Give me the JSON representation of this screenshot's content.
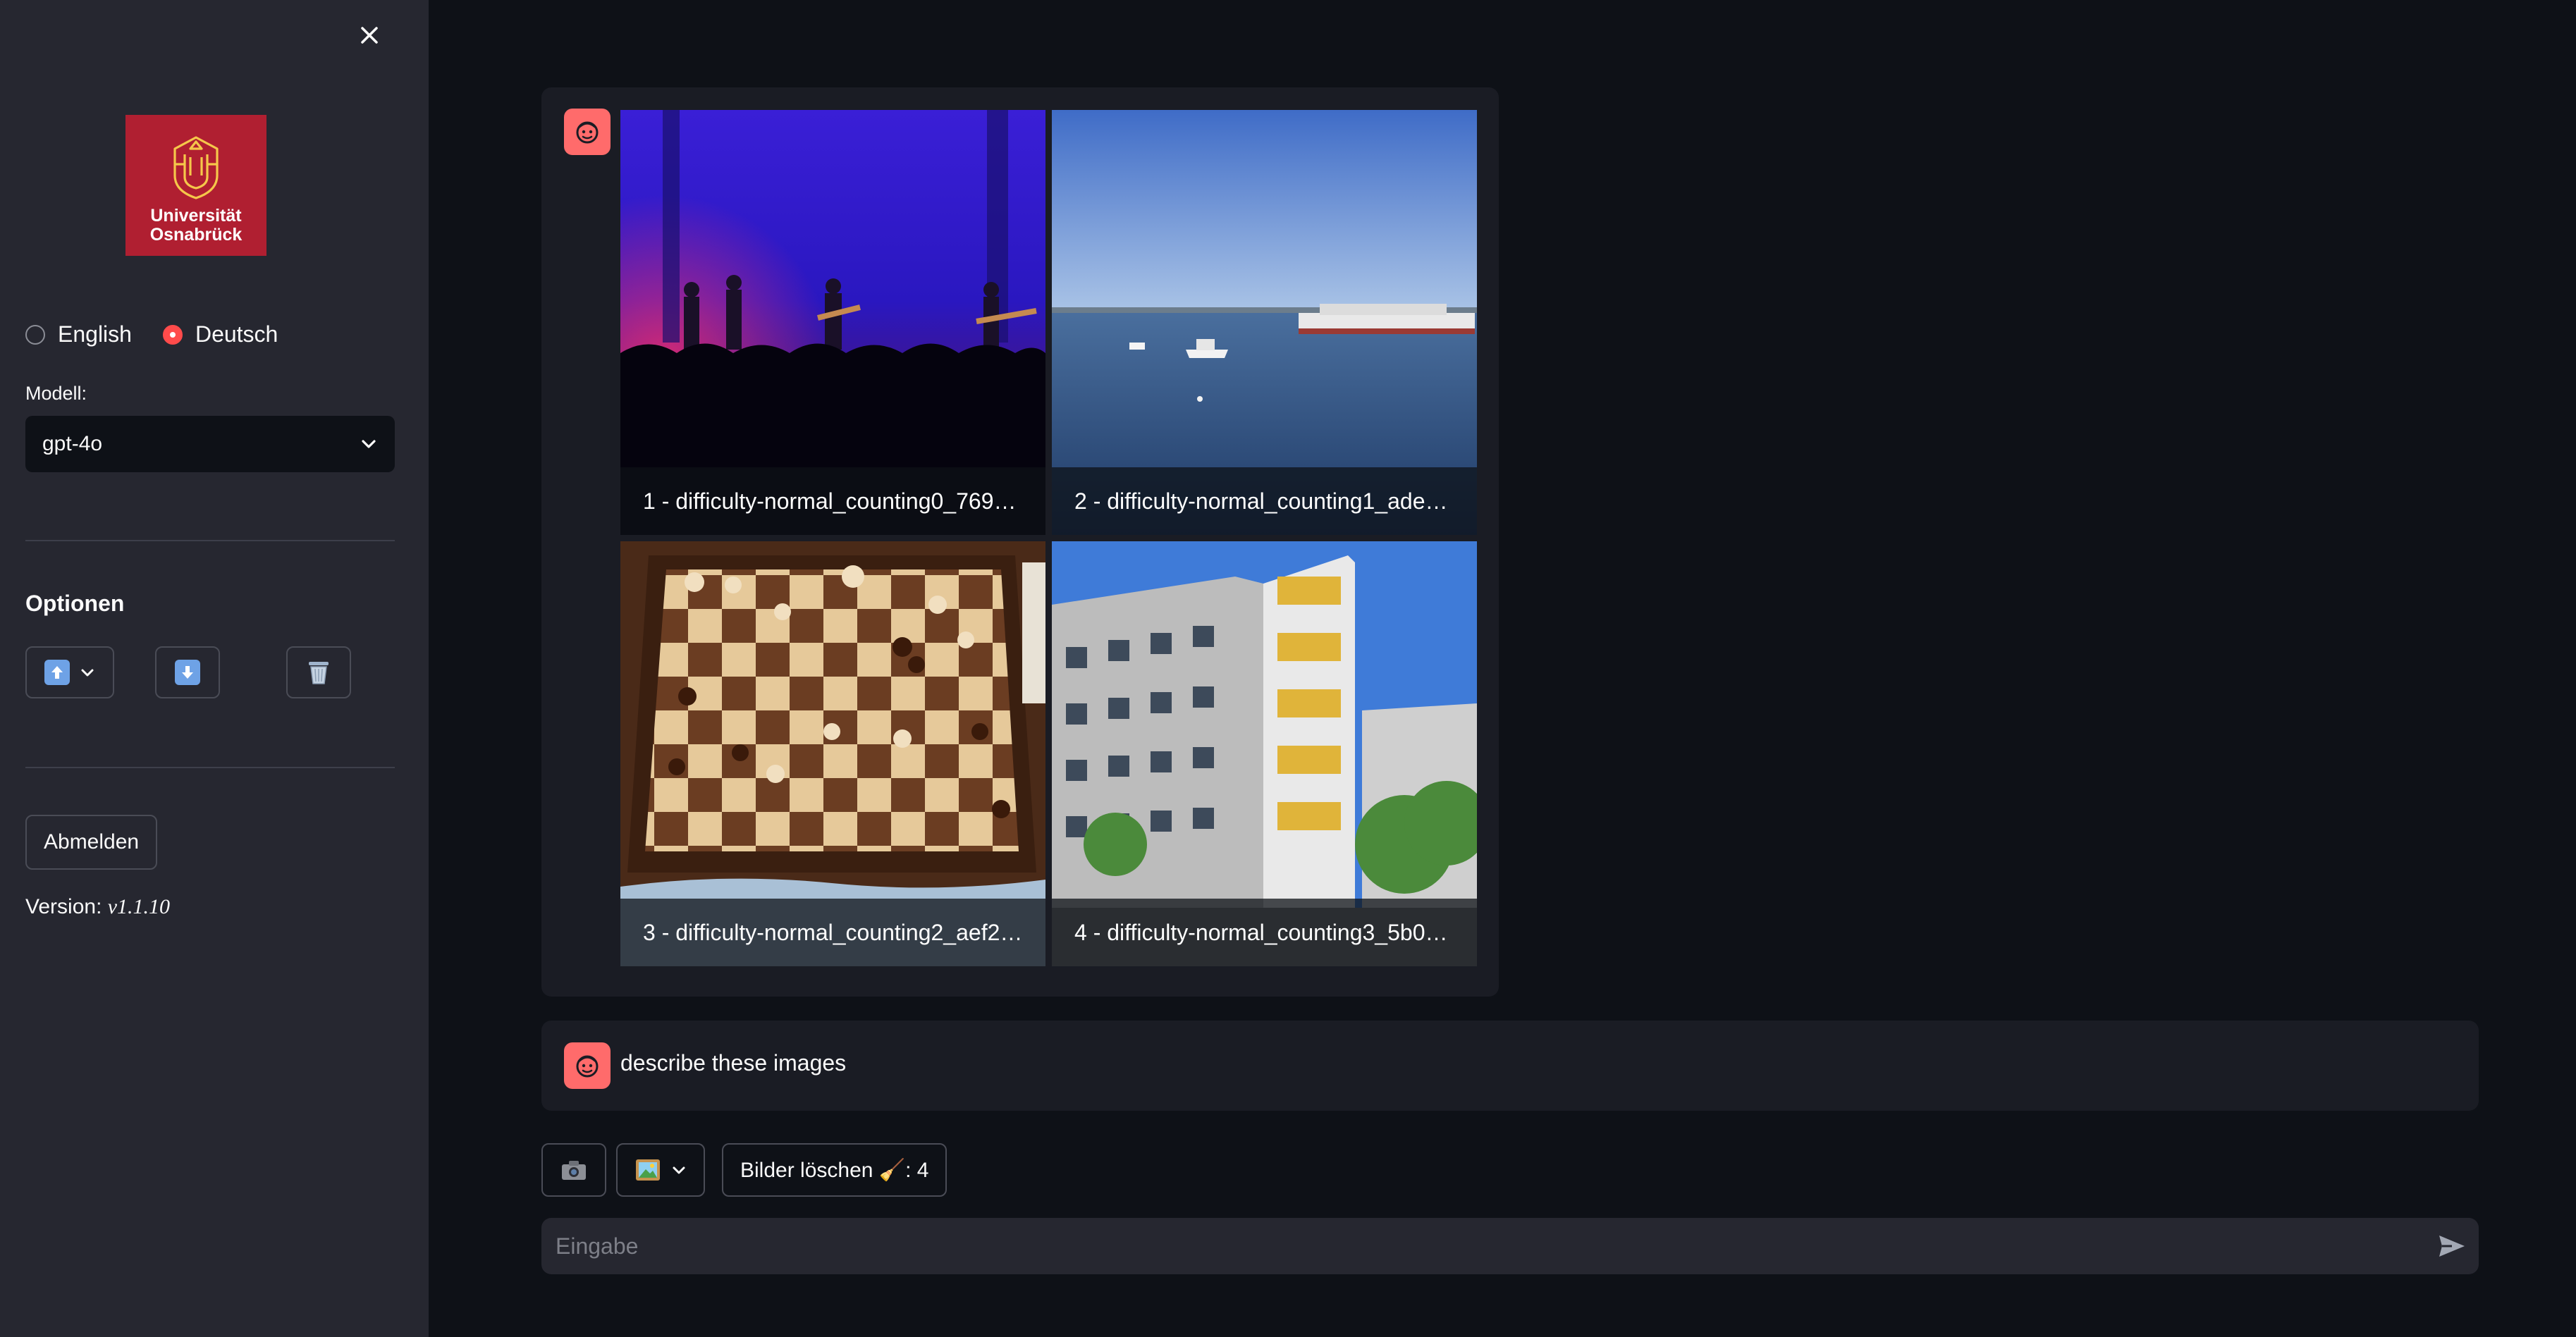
{
  "sidebar": {
    "close_icon": "close-icon",
    "logo": {
      "line1": "Universität",
      "line2": "Osnabrück",
      "color": "#b01f31"
    },
    "language": {
      "options": [
        "English",
        "Deutsch"
      ],
      "selected": "Deutsch"
    },
    "model_label": "Modell:",
    "model_value": "gpt-4o",
    "options_heading": "Optionen",
    "option_icons": [
      "upload-icon",
      "download-icon",
      "trash-icon"
    ],
    "logout_label": "Abmelden",
    "version_label": "Version: ",
    "version_value": "v1.1.10"
  },
  "chat": {
    "images": [
      {
        "caption": "1 - difficulty-normal_counting0_769…"
      },
      {
        "caption": "2 - difficulty-normal_counting1_ade…"
      },
      {
        "caption": "3 - difficulty-normal_counting2_aef2…"
      },
      {
        "caption": "4 - difficulty-normal_counting3_5b0…"
      }
    ],
    "user_message": "describe these images"
  },
  "toolbar": {
    "camera_icon": "camera-icon",
    "image_icon": "image-icon",
    "clear_label": "Bilder löschen 🧹: 4"
  },
  "input": {
    "placeholder": "Eingabe",
    "send_icon": "send-icon"
  },
  "colors": {
    "accent": "#ff4b4b",
    "background": "#0e1117",
    "sidebar": "#262730"
  }
}
